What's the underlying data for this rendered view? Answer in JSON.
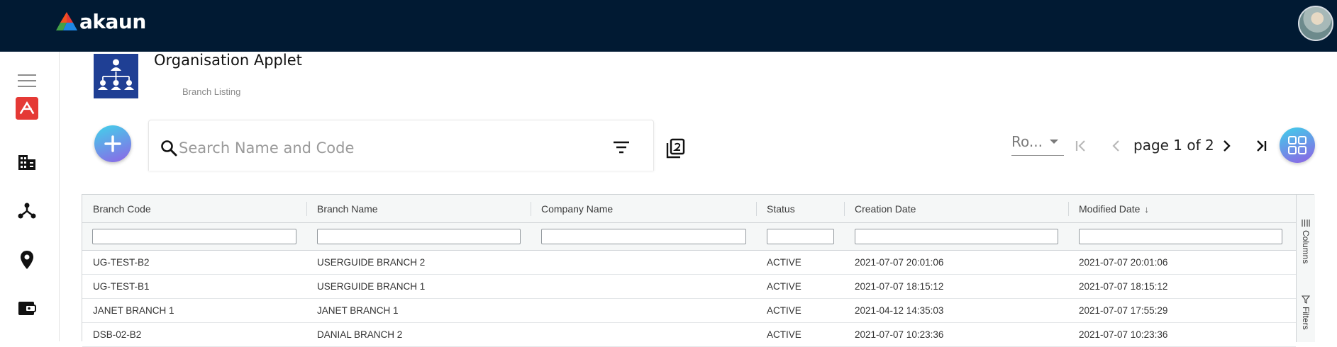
{
  "brand": {
    "name": "akaun"
  },
  "applet": {
    "title": "Organisation Applet",
    "subtitle": "Branch Listing"
  },
  "search": {
    "placeholder": "Search Name and Code",
    "value": ""
  },
  "pagination": {
    "rows_label": "Ro...",
    "page_text": "page 1 of 2"
  },
  "sidebar": {
    "items": [
      {
        "name": "menu-icon"
      },
      {
        "name": "akaun-app-icon"
      },
      {
        "name": "company-icon"
      },
      {
        "name": "organisation-tree-icon"
      },
      {
        "name": "location-pin-icon"
      },
      {
        "name": "wallet-icon"
      }
    ]
  },
  "grid": {
    "columns": [
      "Branch Code",
      "Branch Name",
      "Company Name",
      "Status",
      "Creation Date",
      "Modified Date"
    ],
    "sort_indicator": "↓",
    "side_tabs": [
      "Columns",
      "Filters"
    ],
    "rows": [
      [
        "UG-TEST-B2",
        "USERGUIDE BRANCH 2",
        "",
        "ACTIVE",
        "2021-07-07 20:01:06",
        "2021-07-07 20:01:06"
      ],
      [
        "UG-TEST-B1",
        "USERGUIDE BRANCH 1",
        "",
        "ACTIVE",
        "2021-07-07 18:15:12",
        "2021-07-07 18:15:12"
      ],
      [
        "JANET BRANCH 1",
        "JANET BRANCH 1",
        "",
        "ACTIVE",
        "2021-04-12 14:35:03",
        "2021-07-07 17:55:29"
      ],
      [
        "DSB-02-B2",
        "DANIAL BRANCH 2",
        "",
        "ACTIVE",
        "2021-07-07 10:23:36",
        "2021-07-07 10:23:36"
      ]
    ]
  },
  "colors": {
    "topbar": "#011a33",
    "accent_start": "#41d3ea",
    "accent_end": "#8e63e6",
    "applet_logo": "#1f3f94",
    "app_icon_red": "#e53935"
  }
}
